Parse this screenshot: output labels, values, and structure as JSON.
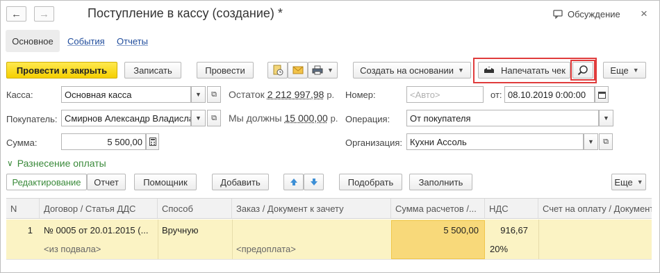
{
  "window": {
    "title": "Поступление в кассу (создание) *",
    "discussion_label": "Обсуждение",
    "back_glyph": "←",
    "forward_glyph": "→",
    "close_glyph": "×"
  },
  "tabs": [
    {
      "label": "Основное",
      "active": true
    },
    {
      "label": "События",
      "active": false
    },
    {
      "label": "Отчеты",
      "active": false
    }
  ],
  "toolbar": {
    "post_close": "Провести и закрыть",
    "save": "Записать",
    "post": "Провести",
    "create_based": "Создать на основании",
    "print_check": "Напечатать чек",
    "more": "Еще"
  },
  "form": {
    "cash_label": "Касса:",
    "cash_value": "Основная касса",
    "balance_label": "Остаток",
    "balance_value": "2 212 997,98",
    "balance_unit": "р.",
    "buyer_label": "Покупатель:",
    "buyer_value": "Смирнов Александр Владисла",
    "owe_label": "Мы должны",
    "owe_value": "15 000,00",
    "owe_unit": "р.",
    "sum_label": "Сумма:",
    "sum_value": "5 500,00",
    "number_label": "Номер:",
    "number_placeholder": "<Авто>",
    "from_label": "от:",
    "date_value": "08.10.2019  0:00:00",
    "operation_label": "Операция:",
    "operation_value": "От покупателя",
    "org_label": "Организация:",
    "org_value": "Кухни Ассоль"
  },
  "section": {
    "title": "Разнесение оплаты",
    "chevron": "∨"
  },
  "table_toolbar": {
    "edit": "Редактирование",
    "report": "Отчет",
    "helper": "Помощник",
    "add": "Добавить",
    "pick": "Подобрать",
    "fill": "Заполнить",
    "more": "Еще"
  },
  "table": {
    "headers": [
      "N",
      "Договор / Статья ДДС",
      "Способ",
      "Заказ / Документ к зачету",
      "Сумма расчетов /...",
      "НДС",
      "Счет на оплату / Документ"
    ],
    "row": {
      "n": "1",
      "contract": "№ 0005 от 20.01.2015 (...",
      "contract_sub": "<из подвала>",
      "method": "Вручную",
      "order": "",
      "order_sub": "<предоплата>",
      "sum": "5 500,00",
      "vat": "916,67",
      "vat_rate": "20%",
      "invoice": ""
    }
  },
  "colors": {
    "accent_yellow": "#f5cf00",
    "link_blue": "#1e4b9b",
    "section_green": "#3a8a3a",
    "row_highlight": "#fbf3c4",
    "selected_cell": "#f8d97a",
    "highlight_box": "#e03c3c"
  }
}
